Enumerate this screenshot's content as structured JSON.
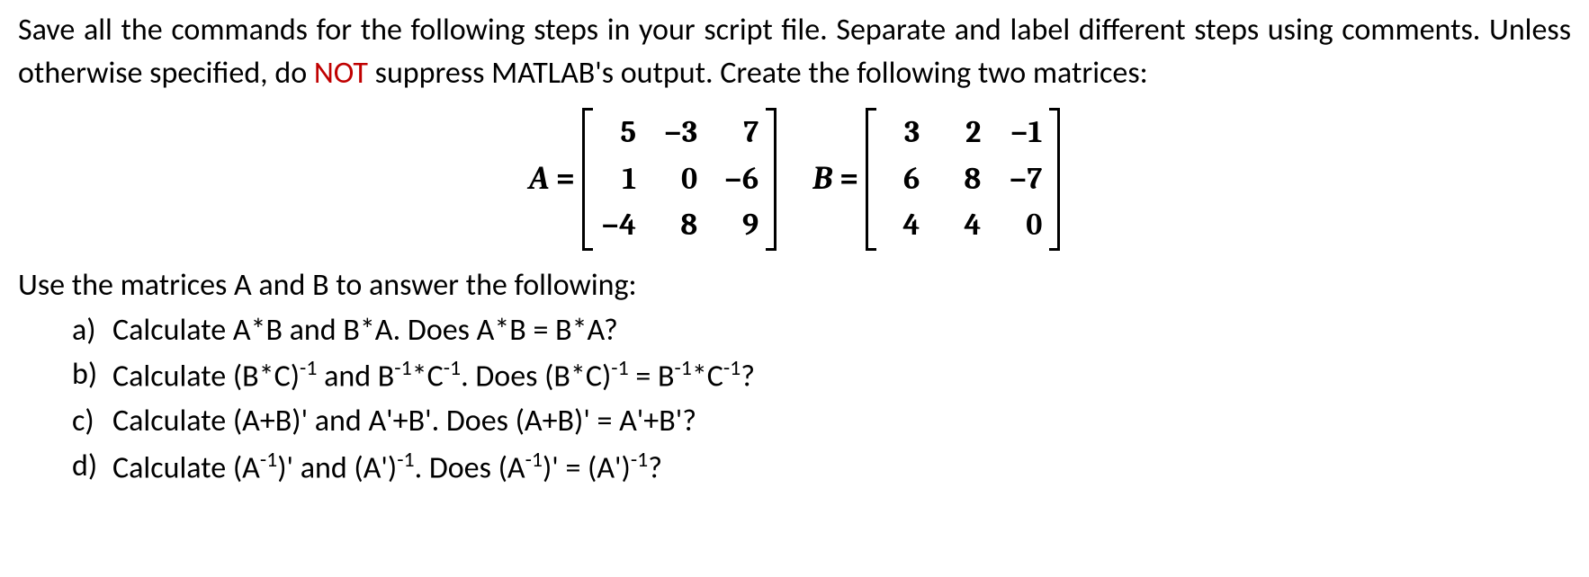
{
  "intro": {
    "part1": "Save all the commands for the following steps in your script file. Separate and label different steps using comments. Unless otherwise specified, do ",
    "not": "NOT",
    "part2": " suppress MATLAB's output. Create the following two matrices:"
  },
  "matrices": {
    "A": {
      "label": "A",
      "equals": "=",
      "rows": [
        [
          "5",
          "−3",
          "7"
        ],
        [
          "1",
          "0",
          "−6"
        ],
        [
          "−4",
          "8",
          "9"
        ]
      ]
    },
    "B": {
      "label": "B",
      "equals": "=",
      "rows": [
        [
          "3",
          "2",
          "−1"
        ],
        [
          "6",
          "8",
          "−7"
        ],
        [
          "4",
          "4",
          "0"
        ]
      ]
    }
  },
  "subheading": "Use the matrices A and B to answer the following:",
  "questions": {
    "a": {
      "letter": "a)",
      "text": "Calculate A*B and B*A. Does A*B = B*A?"
    },
    "b": {
      "letter": "b)",
      "html": "Calculate (B*C)<sup>-1</sup> and B<sup>-1</sup>*C<sup>-1</sup>. Does (B*C)<sup>-1</sup> = B<sup>-1</sup>*C<sup>-1</sup>?"
    },
    "c": {
      "letter": "c)",
      "text": "Calculate (A+B)' and A'+B'. Does (A+B)' = A'+B'?"
    },
    "d": {
      "letter": "d)",
      "html": "Calculate (A<sup>-1</sup>)' and (A')<sup>-1</sup>. Does (A<sup>-1</sup>)' = (A')<sup>-1</sup>?"
    }
  }
}
